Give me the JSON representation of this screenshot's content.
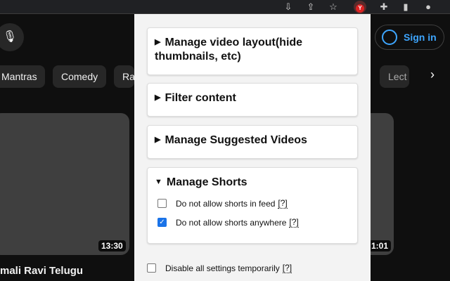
{
  "toolbar": {
    "icons": [
      "install-icon",
      "share-icon",
      "star-icon",
      "extension-y-icon",
      "puzzle-icon",
      "sidepanel-icon",
      "profile-icon"
    ],
    "ext_letter": "Y"
  },
  "youtube": {
    "chips": [
      "Mantras",
      "Comedy",
      "Ra",
      "Lect"
    ],
    "sign_in": "Sign in",
    "videos": [
      {
        "duration": "13:30",
        "title": "mali Ravi Telugu"
      },
      {
        "duration": "1:01"
      }
    ]
  },
  "popup": {
    "sections": [
      {
        "title": "Manage video layout(hide thumbnails, etc)",
        "expanded": false
      },
      {
        "title": "Filter content",
        "expanded": false
      },
      {
        "title": "Manage Suggested Videos",
        "expanded": false
      },
      {
        "title": "Manage Shorts",
        "expanded": true,
        "options": [
          {
            "label": "Do not allow shorts in feed",
            "help": "[?]",
            "checked": false
          },
          {
            "label": "Do not allow shorts anywhere",
            "help": "[?]",
            "checked": true
          }
        ]
      }
    ],
    "disable_all": {
      "label": "Disable all settings temporarily",
      "help": "[?]",
      "checked": false
    }
  },
  "colors": {
    "accent": "#1a73e8",
    "link": "#3ea6ff"
  }
}
